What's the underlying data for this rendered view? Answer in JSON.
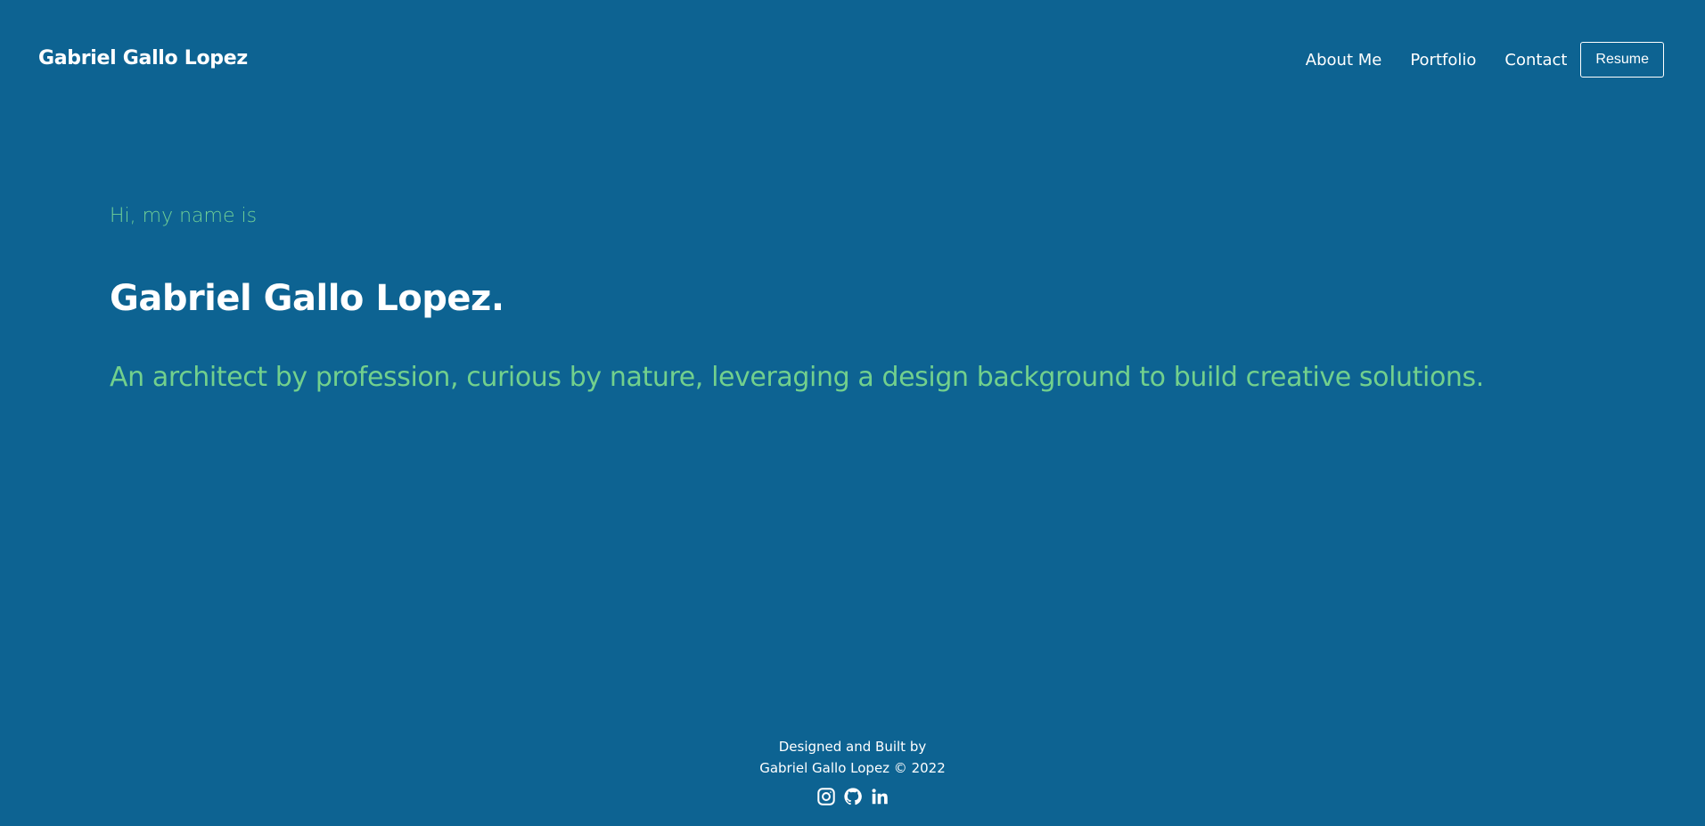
{
  "header": {
    "brand": "Gabriel Gallo Lopez",
    "nav": [
      {
        "label": "About Me"
      },
      {
        "label": "Portfolio"
      },
      {
        "label": "Contact"
      }
    ],
    "resume_label": "Resume"
  },
  "hero": {
    "greeting": "Hi, my name is",
    "name": "Gabriel Gallo Lopez.",
    "tagline": "An architect by profession, curious by nature, leveraging a design background to build creative solutions."
  },
  "footer": {
    "line1": "Designed and Built by",
    "line2": "Gabriel Gallo Lopez © 2022",
    "social": [
      {
        "icon": "instagram-icon"
      },
      {
        "icon": "github-icon"
      },
      {
        "icon": "linkedin-icon"
      }
    ]
  },
  "colors": {
    "background": "#0d6392",
    "accent": "#72d08d",
    "text": "#ffffff"
  }
}
